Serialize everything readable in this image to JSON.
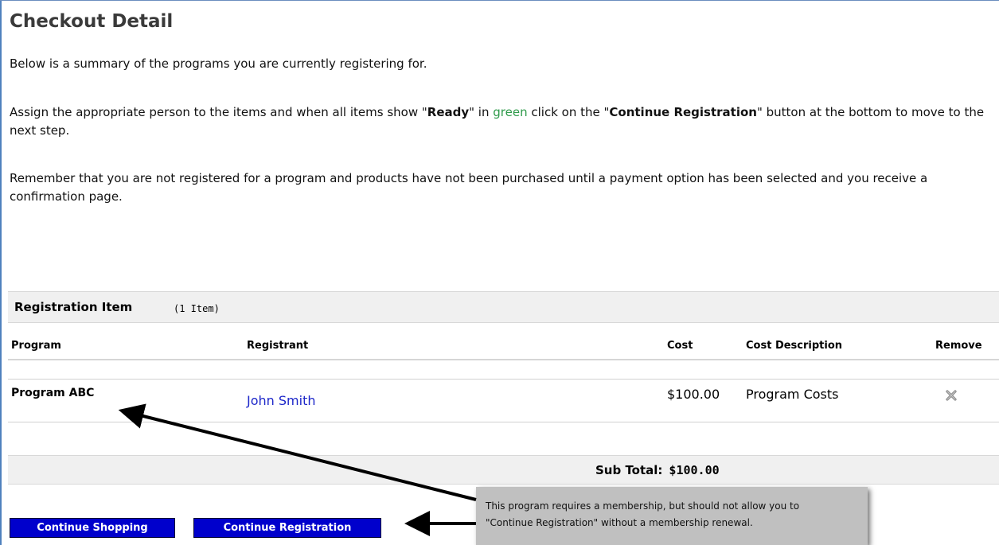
{
  "page": {
    "title": "Checkout Detail",
    "intro": "Below is a summary of the programs you are currently registering for.",
    "instructions": {
      "part1": "Assign the appropriate person to the items and when all items show \"",
      "ready": "Ready",
      "part2": "\" in ",
      "green": "green",
      "part3": " click on the \"",
      "continue": "Continue Registration",
      "part4": "\" button at the bottom to move to the next step."
    },
    "reminder": "Remember that you are not registered for a program and products have not been purchased until a payment option has been selected and you receive a confirmation page."
  },
  "registration": {
    "title": "Registration Item",
    "count": "(1 Item)",
    "columns": {
      "program": "Program",
      "registrant": "Registrant",
      "cost": "Cost",
      "cost_description": "Cost Description",
      "remove": "Remove"
    },
    "rows": [
      {
        "program": "Program ABC",
        "registrant": "John Smith",
        "cost": "$100.00",
        "cost_description": "Program Costs"
      }
    ],
    "subtotal_label": "Sub Total:",
    "subtotal_value": "$100.00"
  },
  "buttons": {
    "continue_shopping": "Continue Shopping",
    "continue_registration": "Continue Registration"
  },
  "annotation": {
    "line1": "This program requires a membership, but should not allow you to",
    "line2": "\"Continue Registration\" without a membership renewal."
  },
  "colors": {
    "button_bg": "#0000cc",
    "link": "#1d27c9",
    "ready_green": "#2e9a4a",
    "callout_bg": "#c0c0c0"
  },
  "icons": {
    "remove": "close-x-icon"
  }
}
